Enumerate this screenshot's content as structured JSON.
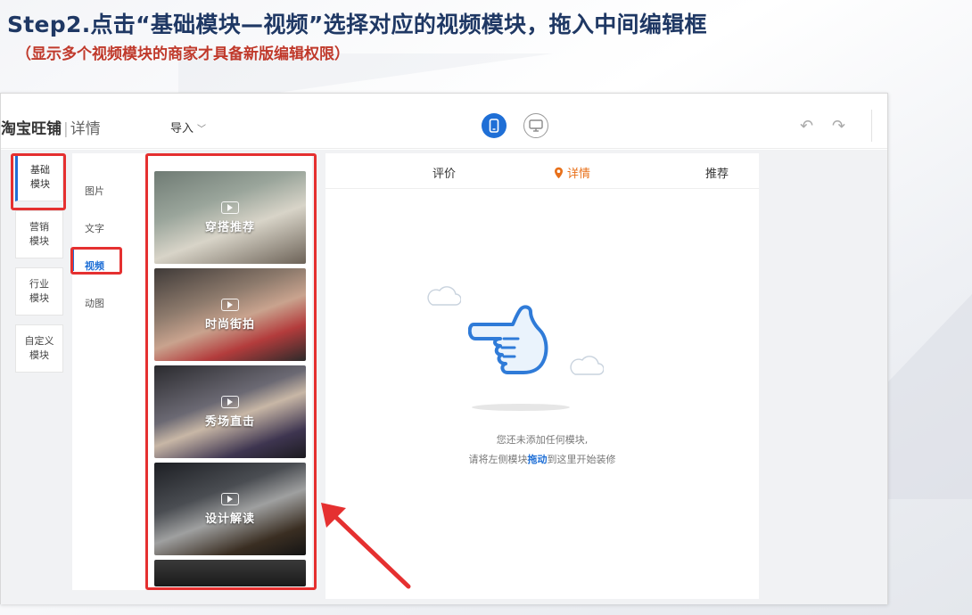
{
  "header": {
    "title": "Step2.点击“基础模块—视频”选择对应的视频模块，拖入中间编辑框",
    "subtitle": "（显示多个视频模块的商家才具备新版编辑权限）"
  },
  "topbar": {
    "brand": "淘宝旺铺",
    "divider": "|",
    "page_label": "详情",
    "import_label": "导入",
    "import_icon": "chevron-down-icon",
    "mobile_icon": "mobile-icon",
    "desktop_icon": "desktop-icon",
    "undo_icon": "undo-icon",
    "redo_icon": "redo-icon"
  },
  "categories": [
    {
      "label": "基础\n模块",
      "active": true
    },
    {
      "label": "营销\n模块",
      "active": false
    },
    {
      "label": "行业\n模块",
      "active": false
    },
    {
      "label": "自定义\n模块",
      "active": false
    }
  ],
  "subcategories": [
    {
      "label": "图片",
      "active": false
    },
    {
      "label": "文字",
      "active": false
    },
    {
      "label": "视频",
      "active": true
    },
    {
      "label": "动图",
      "active": false
    }
  ],
  "video_modules": [
    {
      "label": "穿搭推荐",
      "icon": "video-play-icon"
    },
    {
      "label": "时尚街拍",
      "icon": "video-play-icon"
    },
    {
      "label": "秀场直击",
      "icon": "video-play-icon"
    },
    {
      "label": "设计解读",
      "icon": "video-play-icon"
    }
  ],
  "preview": {
    "tabs": [
      "评价",
      "详情",
      "推荐"
    ],
    "active_tab": "详情",
    "location_icon": "location-pin-icon",
    "empty_line1": "您还未添加任何模块,",
    "empty_line2_prefix": "请将左侧模块",
    "empty_line2_highlight": "拖动",
    "empty_line2_suffix": "到这里开始装修",
    "illustration_icon": "pointing-hand-icon"
  },
  "annotation": {
    "color": "#e53030",
    "arrow_icon": "red-arrow-icon"
  },
  "colors": {
    "title": "#1f3864",
    "subtitle": "#c0392b",
    "accent_blue": "#1f6fd6",
    "accent_orange": "#e8701a"
  }
}
